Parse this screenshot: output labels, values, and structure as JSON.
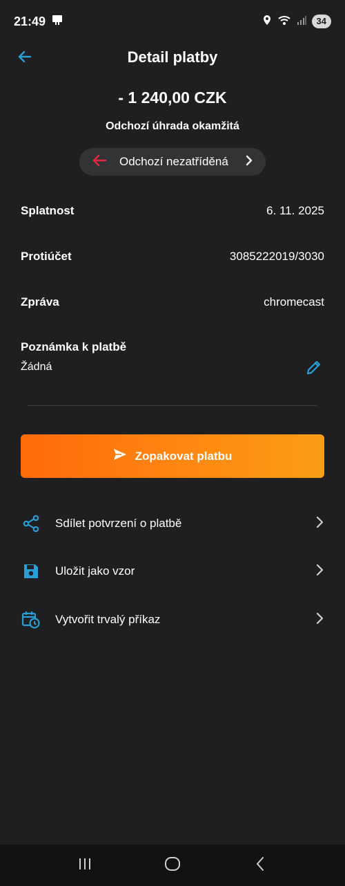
{
  "status_bar": {
    "time": "21:49",
    "battery": "34",
    "icons": [
      "notification-icon",
      "location-icon",
      "wifi-icon",
      "signal-icon"
    ]
  },
  "header": {
    "title": "Detail platby",
    "back_icon": "arrow-left-icon"
  },
  "payment": {
    "amount": "- 1 240,00 CZK",
    "type": "Odchozí úhrada okamžitá",
    "category": "Odchozí nezatříděná"
  },
  "details": [
    {
      "label": "Splatnost",
      "value": "6. 11. 2025"
    },
    {
      "label": "Protiúčet",
      "value": "3085222019/3030"
    },
    {
      "label": "Zpráva",
      "value": "chromecast"
    }
  ],
  "note": {
    "label": "Poznámka k platbě",
    "value": "Žádná"
  },
  "repeat_button": {
    "label": "Zopakovat platbu"
  },
  "actions": [
    {
      "label": "Sdílet potvrzení o platbě",
      "icon": "share-icon"
    },
    {
      "label": "Uložit jako vzor",
      "icon": "save-icon"
    },
    {
      "label": "Vytvořit trvalý příkaz",
      "icon": "calendar-clock-icon"
    }
  ],
  "colors": {
    "background": "#1f1f21",
    "accent_blue": "#2a9fd6",
    "accent_red": "#e8253e",
    "button_orange_start": "#ff6a0a",
    "button_orange_end": "#fa9e16",
    "chip_background": "#333335"
  }
}
